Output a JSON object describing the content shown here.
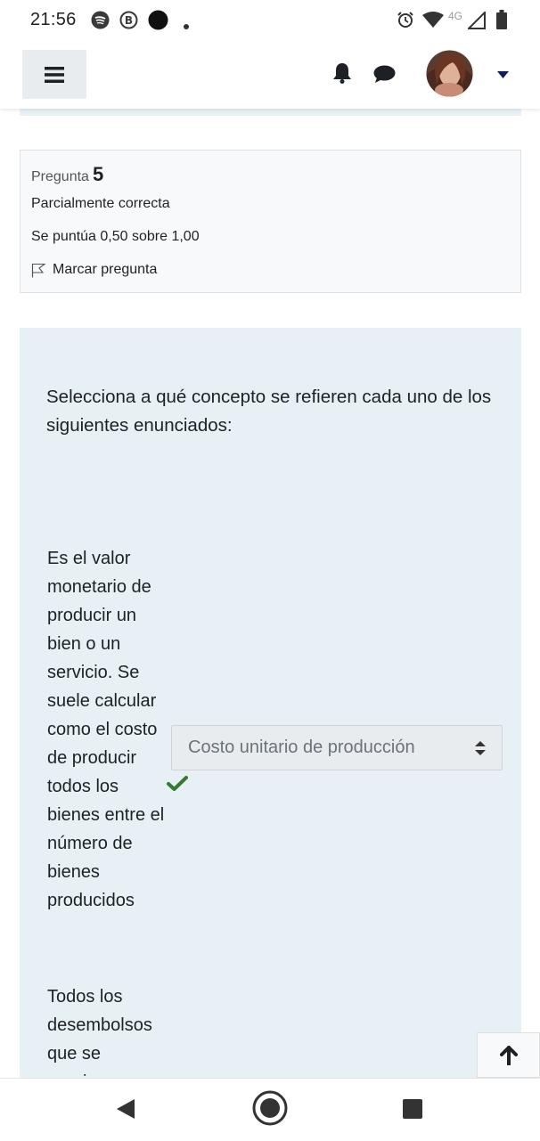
{
  "status_bar": {
    "time": "21:56",
    "network": "4G",
    "icons": [
      "spotify-icon",
      "b-icon",
      "dot-icon",
      "small-dot-icon",
      "alarm-icon",
      "wifi-icon",
      "signal-icon",
      "battery-icon"
    ]
  },
  "header": {
    "menu_icon": "hamburger-menu-icon",
    "icons": [
      "bell-icon",
      "chat-icon",
      "avatar",
      "caret-down-icon"
    ]
  },
  "question_info": {
    "label": "Pregunta",
    "number": "5",
    "state": "Parcialmente correcta",
    "grade": "Se puntúa 0,50 sobre 1,00",
    "flag_label": "Marcar pregunta"
  },
  "question": {
    "prompt": "Selecciona a qué concepto se refieren cada uno de los siguientes enunciados:",
    "items": [
      {
        "stem": "Es el valor monetario de producir un bien o un servicio. Se suele calcular como el costo de producir todos los bienes entre el número de bienes producidos",
        "selected": "Costo unitario de producción",
        "status": "correct"
      },
      {
        "stem": "Todos los desembolsos que se requieren"
      }
    ]
  },
  "colors": {
    "content_bg": "#e7f1f5",
    "check": "#357a32",
    "header_dark": "#0f1d5e"
  },
  "nav_bar": {
    "icons": [
      "back-icon",
      "home-icon",
      "recents-icon"
    ]
  }
}
